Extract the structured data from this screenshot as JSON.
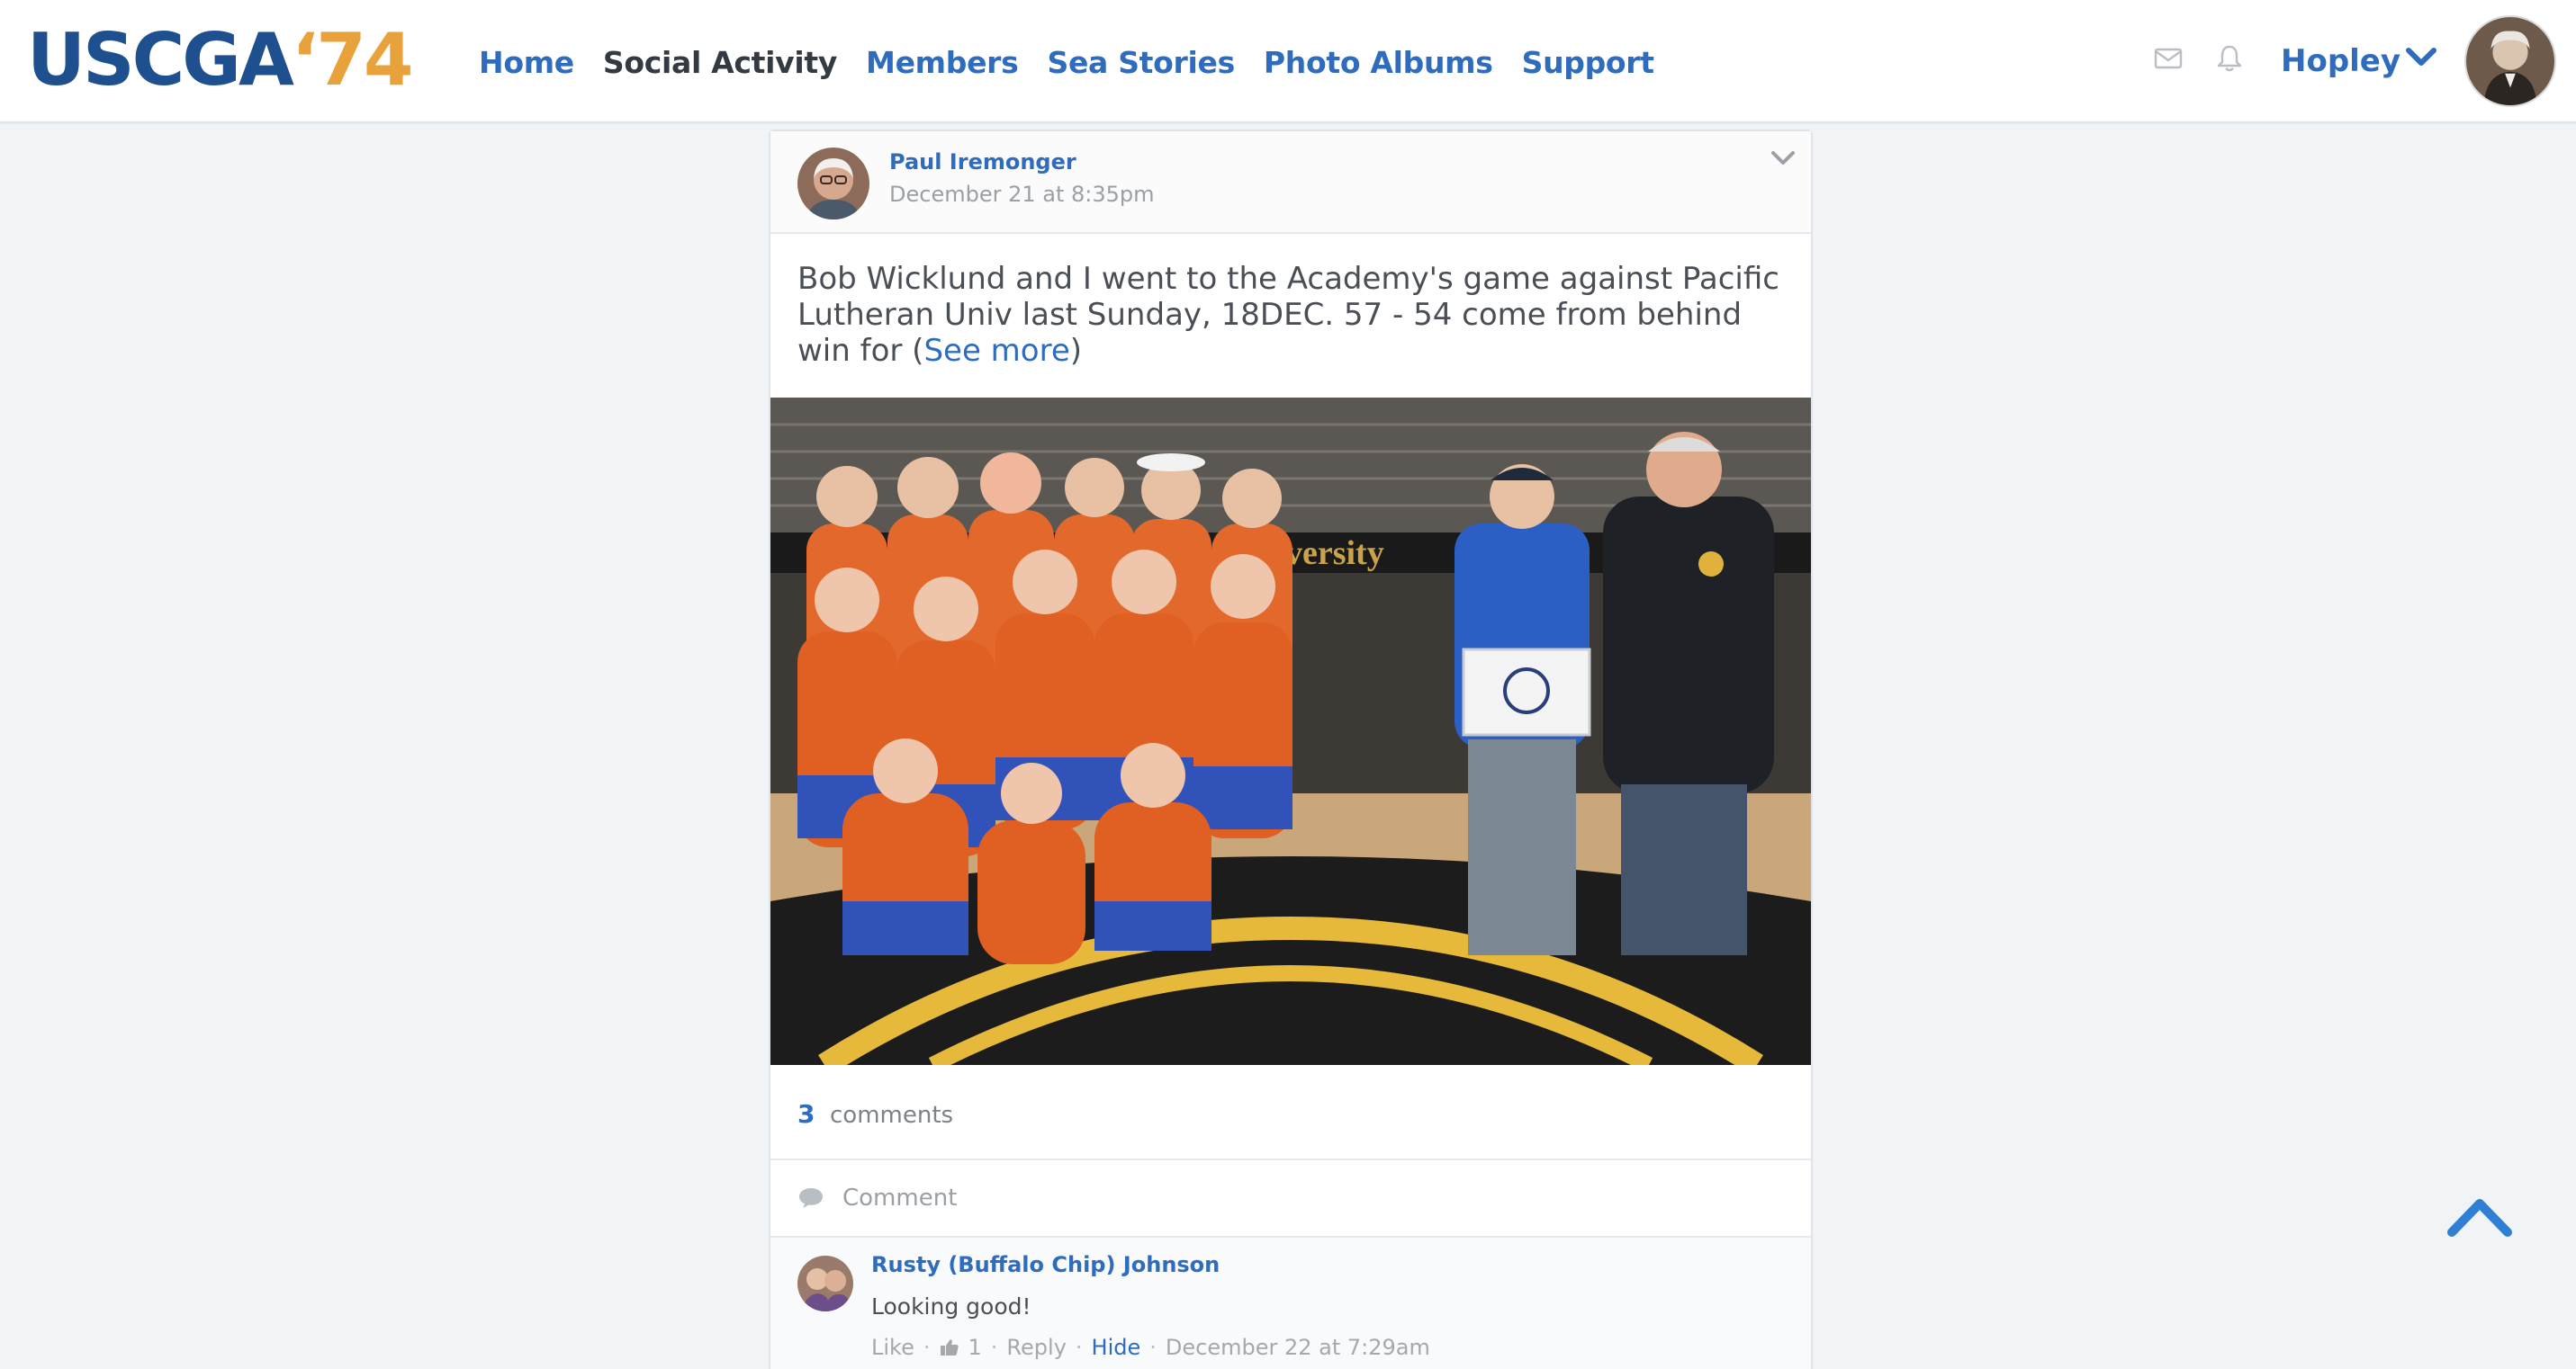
{
  "brand": {
    "logo_part1": "USCGA",
    "logo_part2": "‘74",
    "accent_blue": "#2f6cbd",
    "accent_gold": "#e8a23b"
  },
  "nav": {
    "items": [
      {
        "label": "Home",
        "active": false
      },
      {
        "label": "Social Activity",
        "active": true
      },
      {
        "label": "Members",
        "active": false
      },
      {
        "label": "Sea Stories",
        "active": false
      },
      {
        "label": "Photo Albums",
        "active": false
      },
      {
        "label": "Support",
        "active": false
      }
    ]
  },
  "header": {
    "icons": [
      "mail-icon",
      "bell-icon"
    ],
    "user_name": "Hopley"
  },
  "post": {
    "author": "Paul Iremonger",
    "date": "December 21 at 8:35pm",
    "text": "Bob Wicklund and I went to the Academy's game against Pacific Lutheran Univ last Sunday, 18DEC. 57 - 54 come from behind win for (",
    "see_more": "See more",
    "text_close": ")",
    "comments_count": "3",
    "comments_label": "comments",
    "comment_placeholder": "Comment"
  },
  "comments": [
    {
      "author": "Rusty (Buffalo Chip) Johnson",
      "text": "Looking good!",
      "like_label": "Like",
      "like_count": "1",
      "reply_label": "Reply",
      "hide_label": "Hide",
      "date": "December 22 at 7:29am"
    }
  ]
}
